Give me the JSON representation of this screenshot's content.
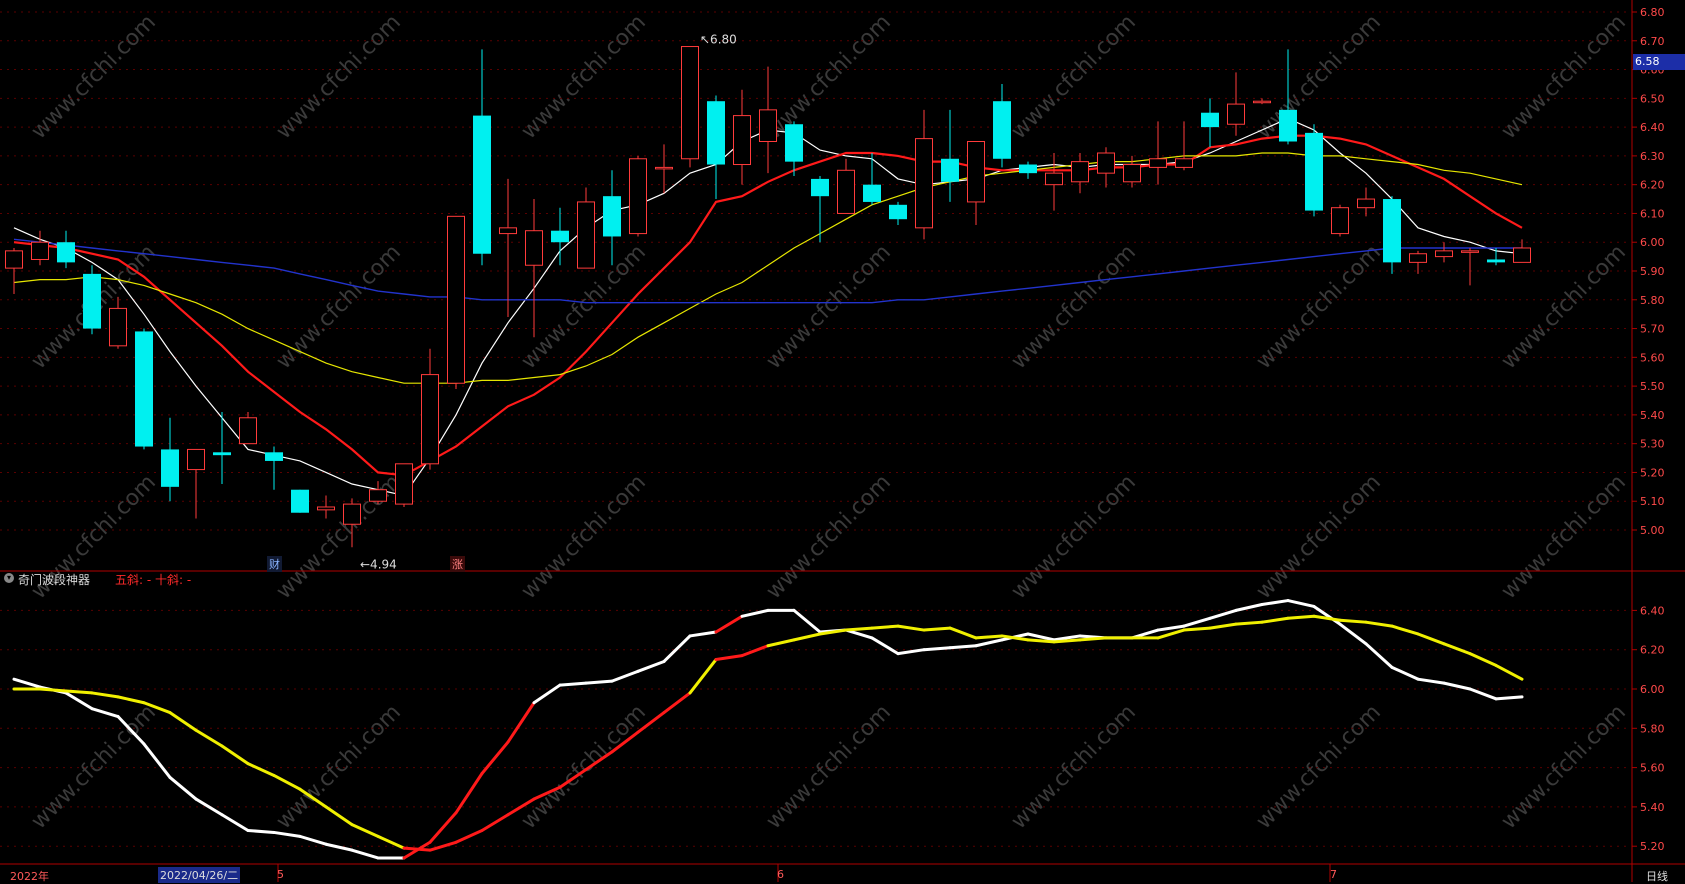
{
  "upper_axis": {
    "ticks": [
      "6.80",
      "6.70",
      "6.60",
      "6.50",
      "6.40",
      "6.30",
      "6.20",
      "6.10",
      "6.00",
      "5.90",
      "5.80",
      "5.70",
      "5.60",
      "5.50",
      "5.40",
      "5.30",
      "5.20",
      "5.10",
      "5.00"
    ],
    "last_price": "6.58"
  },
  "lower_axis": {
    "ticks": [
      "6.40",
      "6.20",
      "6.00",
      "5.80",
      "5.60",
      "5.40",
      "5.20"
    ]
  },
  "annotations": {
    "high": "6.80",
    "low": "4.94"
  },
  "markers": {
    "cai": "财",
    "zhang": "涨"
  },
  "indicator": {
    "title": "奇门波段神器",
    "params": "五斜: -  十斜: -"
  },
  "time_axis": {
    "year_label": "2022年",
    "cursor_date": "2022/04/26/二",
    "month_labels": [
      "5",
      "6",
      "7"
    ],
    "period": "日线"
  },
  "watermark": "www.cfchi.com",
  "colors": {
    "bull": "#ff3b3b",
    "bear": "#00f0f0",
    "ma_short": "#ffffff",
    "ma_red": "#ff1a1a",
    "ma_yellow": "#e6e600",
    "ma_blue": "#2233cc",
    "axis": "#b00000"
  },
  "chart_data": {
    "type": "candlestick",
    "ylim": [
      4.94,
      6.84
    ],
    "candles": [
      {
        "o": 5.91,
        "c": 5.97,
        "h": 5.98,
        "l": 5.82
      },
      {
        "o": 5.94,
        "c": 6.0,
        "h": 6.04,
        "l": 5.92
      },
      {
        "o": 6.0,
        "c": 5.93,
        "h": 6.04,
        "l": 5.91
      },
      {
        "o": 5.89,
        "c": 5.7,
        "h": 5.92,
        "l": 5.68
      },
      {
        "o": 5.64,
        "c": 5.77,
        "h": 5.81,
        "l": 5.63
      },
      {
        "o": 5.69,
        "c": 5.29,
        "h": 5.7,
        "l": 5.28
      },
      {
        "o": 5.28,
        "c": 5.15,
        "h": 5.39,
        "l": 5.1
      },
      {
        "o": 5.21,
        "c": 5.28,
        "h": 5.28,
        "l": 5.04
      },
      {
        "o": 5.27,
        "c": 5.26,
        "h": 5.41,
        "l": 5.16
      },
      {
        "o": 5.3,
        "c": 5.39,
        "h": 5.41,
        "l": 5.3
      },
      {
        "o": 5.27,
        "c": 5.24,
        "h": 5.29,
        "l": 5.14
      },
      {
        "o": 5.14,
        "c": 5.06,
        "h": 5.14,
        "l": 5.06
      },
      {
        "o": 5.07,
        "c": 5.08,
        "h": 5.12,
        "l": 5.04
      },
      {
        "o": 5.02,
        "c": 5.09,
        "h": 5.11,
        "l": 4.94
      },
      {
        "o": 5.1,
        "c": 5.14,
        "h": 5.17,
        "l": 5.09
      },
      {
        "o": 5.09,
        "c": 5.23,
        "h": 5.23,
        "l": 5.08
      },
      {
        "o": 5.23,
        "c": 5.54,
        "h": 5.63,
        "l": 5.21
      },
      {
        "o": 5.51,
        "c": 6.09,
        "h": 6.09,
        "l": 5.49
      },
      {
        "o": 6.44,
        "c": 5.96,
        "h": 6.67,
        "l": 5.92
      },
      {
        "o": 6.03,
        "c": 6.05,
        "h": 6.22,
        "l": 5.74
      },
      {
        "o": 5.92,
        "c": 6.04,
        "h": 6.15,
        "l": 5.67
      },
      {
        "o": 6.04,
        "c": 6.0,
        "h": 6.12,
        "l": 5.92
      },
      {
        "o": 5.91,
        "c": 6.14,
        "h": 6.19,
        "l": 5.91
      },
      {
        "o": 6.16,
        "c": 6.02,
        "h": 6.25,
        "l": 5.92
      },
      {
        "o": 6.03,
        "c": 6.29,
        "h": 6.3,
        "l": 6.02
      },
      {
        "o": 6.26,
        "c": 6.26,
        "h": 6.34,
        "l": 6.17
      },
      {
        "o": 6.29,
        "c": 6.68,
        "h": 6.68,
        "l": 6.26
      },
      {
        "o": 6.49,
        "c": 6.27,
        "h": 6.51,
        "l": 6.15
      },
      {
        "o": 6.27,
        "c": 6.44,
        "h": 6.53,
        "l": 6.2
      },
      {
        "o": 6.35,
        "c": 6.46,
        "h": 6.61,
        "l": 6.24
      },
      {
        "o": 6.41,
        "c": 6.28,
        "h": 6.42,
        "l": 6.23
      },
      {
        "o": 6.22,
        "c": 6.16,
        "h": 6.23,
        "l": 6.0
      },
      {
        "o": 6.1,
        "c": 6.25,
        "h": 6.29,
        "l": 6.1
      },
      {
        "o": 6.2,
        "c": 6.14,
        "h": 6.31,
        "l": 6.13
      },
      {
        "o": 6.13,
        "c": 6.08,
        "h": 6.14,
        "l": 6.06
      },
      {
        "o": 6.05,
        "c": 6.36,
        "h": 6.46,
        "l": 6.01
      },
      {
        "o": 6.29,
        "c": 6.21,
        "h": 6.46,
        "l": 6.14
      },
      {
        "o": 6.14,
        "c": 6.35,
        "h": 6.35,
        "l": 6.06
      },
      {
        "o": 6.49,
        "c": 6.29,
        "h": 6.55,
        "l": 6.26
      },
      {
        "o": 6.27,
        "c": 6.24,
        "h": 6.28,
        "l": 6.22
      },
      {
        "o": 6.2,
        "c": 6.24,
        "h": 6.31,
        "l": 6.11
      },
      {
        "o": 6.21,
        "c": 6.28,
        "h": 6.31,
        "l": 6.17
      },
      {
        "o": 6.24,
        "c": 6.31,
        "h": 6.33,
        "l": 6.19
      },
      {
        "o": 6.21,
        "c": 6.27,
        "h": 6.3,
        "l": 6.19
      },
      {
        "o": 6.26,
        "c": 6.29,
        "h": 6.42,
        "l": 6.2
      },
      {
        "o": 6.26,
        "c": 6.29,
        "h": 6.42,
        "l": 6.25
      },
      {
        "o": 6.45,
        "c": 6.4,
        "h": 6.5,
        "l": 6.33
      },
      {
        "o": 6.41,
        "c": 6.48,
        "h": 6.59,
        "l": 6.37
      },
      {
        "o": 6.49,
        "c": 6.49,
        "h": 6.5,
        "l": 6.48
      },
      {
        "o": 6.46,
        "c": 6.35,
        "h": 6.67,
        "l": 6.34
      },
      {
        "o": 6.38,
        "c": 6.11,
        "h": 6.41,
        "l": 6.09
      },
      {
        "o": 6.03,
        "c": 6.12,
        "h": 6.13,
        "l": 6.02
      },
      {
        "o": 6.12,
        "c": 6.15,
        "h": 6.19,
        "l": 6.09
      },
      {
        "o": 6.15,
        "c": 5.93,
        "h": 6.16,
        "l": 5.89
      },
      {
        "o": 5.93,
        "c": 5.96,
        "h": 5.97,
        "l": 5.89
      },
      {
        "o": 5.95,
        "c": 5.97,
        "h": 6.0,
        "l": 5.93
      },
      {
        "o": 5.97,
        "c": 5.97,
        "h": 5.98,
        "l": 5.85
      },
      {
        "o": 5.94,
        "c": 5.93,
        "h": 5.98,
        "l": 5.92
      },
      {
        "o": 5.93,
        "c": 5.98,
        "h": 6.01,
        "l": 5.93
      }
    ],
    "series": [
      {
        "name": "MA5",
        "values": [
          6.05,
          6.01,
          5.98,
          5.93,
          5.87,
          5.75,
          5.62,
          5.5,
          5.39,
          5.28,
          5.26,
          5.24,
          5.2,
          5.16,
          5.14,
          5.12,
          5.25,
          5.4,
          5.58,
          5.72,
          5.84,
          5.97,
          6.05,
          6.11,
          6.13,
          6.17,
          6.24,
          6.27,
          6.35,
          6.39,
          6.38,
          6.32,
          6.3,
          6.29,
          6.22,
          6.2,
          6.21,
          6.22,
          6.25,
          6.26,
          6.27,
          6.26,
          6.27,
          6.27,
          6.27,
          6.28,
          6.31,
          6.35,
          6.39,
          6.43,
          6.39,
          6.31,
          6.24,
          6.15,
          6.05,
          6.02,
          6.0,
          5.97,
          5.96
        ]
      },
      {
        "name": "MA10",
        "values": [
          6.0,
          5.99,
          5.98,
          5.96,
          5.94,
          5.88,
          5.8,
          5.72,
          5.64,
          5.55,
          5.48,
          5.41,
          5.35,
          5.28,
          5.2,
          5.19,
          5.24,
          5.29,
          5.36,
          5.43,
          5.47,
          5.53,
          5.62,
          5.72,
          5.82,
          5.91,
          6.0,
          6.14,
          6.16,
          6.21,
          6.25,
          6.28,
          6.31,
          6.31,
          6.3,
          6.28,
          6.28,
          6.26,
          6.25,
          6.25,
          6.25,
          6.25,
          6.26,
          6.26,
          6.27,
          6.27,
          6.33,
          6.34,
          6.36,
          6.37,
          6.37,
          6.36,
          6.34,
          6.3,
          6.26,
          6.22,
          6.16,
          6.1,
          6.05
        ]
      },
      {
        "name": "MA20",
        "values": [
          5.86,
          5.87,
          5.87,
          5.88,
          5.87,
          5.85,
          5.82,
          5.79,
          5.75,
          5.7,
          5.66,
          5.62,
          5.58,
          5.55,
          5.53,
          5.51,
          5.51,
          5.51,
          5.52,
          5.52,
          5.53,
          5.54,
          5.57,
          5.61,
          5.67,
          5.72,
          5.77,
          5.82,
          5.86,
          5.92,
          5.98,
          6.03,
          6.08,
          6.13,
          6.16,
          6.19,
          6.21,
          6.23,
          6.24,
          6.25,
          6.26,
          6.27,
          6.28,
          6.28,
          6.29,
          6.3,
          6.3,
          6.3,
          6.31,
          6.31,
          6.3,
          6.3,
          6.29,
          6.28,
          6.27,
          6.25,
          6.24,
          6.22,
          6.2
        ]
      },
      {
        "name": "MA60",
        "values": [
          6.01,
          6.0,
          5.99,
          5.98,
          5.97,
          5.96,
          5.95,
          5.94,
          5.93,
          5.92,
          5.91,
          5.89,
          5.87,
          5.85,
          5.83,
          5.82,
          5.81,
          5.81,
          5.8,
          5.8,
          5.8,
          5.8,
          5.79,
          5.79,
          5.79,
          5.79,
          5.79,
          5.79,
          5.79,
          5.79,
          5.79,
          5.79,
          5.79,
          5.79,
          5.8,
          5.8,
          5.81,
          5.82,
          5.83,
          5.84,
          5.85,
          5.86,
          5.87,
          5.88,
          5.89,
          5.9,
          5.91,
          5.92,
          5.93,
          5.94,
          5.95,
          5.96,
          5.97,
          5.98,
          5.98,
          5.98,
          5.98,
          5.98,
          5.98
        ]
      }
    ],
    "indicator_ylim": [
      5.1,
      6.53
    ],
    "indicator_series": [
      {
        "name": "五斜",
        "values": [
          6.05,
          6.01,
          5.98,
          5.9,
          5.86,
          5.72,
          5.55,
          5.44,
          5.36,
          5.28,
          5.27,
          5.25,
          5.21,
          5.18,
          5.14,
          5.14,
          5.22,
          5.37,
          5.57,
          5.73,
          5.93,
          6.02,
          6.03,
          6.04,
          6.09,
          6.14,
          6.27,
          6.29,
          6.37,
          6.4,
          6.4,
          6.29,
          6.3,
          6.26,
          6.18,
          6.2,
          6.21,
          6.22,
          6.25,
          6.28,
          6.25,
          6.27,
          6.26,
          6.26,
          6.3,
          6.32,
          6.36,
          6.4,
          6.43,
          6.45,
          6.42,
          6.33,
          6.23,
          6.11,
          6.05,
          6.03,
          6.0,
          5.95,
          5.96
        ],
        "colors": [
          "w",
          "w",
          "w",
          "w",
          "w",
          "w",
          "w",
          "w",
          "w",
          "w",
          "w",
          "w",
          "w",
          "w",
          "w",
          "r",
          "r",
          "r",
          "r",
          "r",
          "w",
          "w",
          "w",
          "w",
          "w",
          "w",
          "w",
          "r",
          "w",
          "w",
          "w",
          "w",
          "w",
          "w",
          "w",
          "w",
          "w",
          "w",
          "w",
          "w",
          "w",
          "w",
          "w",
          "w",
          "w",
          "w",
          "w",
          "w",
          "w",
          "w",
          "w",
          "w",
          "w",
          "w",
          "w",
          "w",
          "w",
          "w"
        ]
      },
      {
        "name": "十斜",
        "values": [
          6.0,
          6.0,
          5.99,
          5.98,
          5.96,
          5.93,
          5.88,
          5.79,
          5.71,
          5.62,
          5.56,
          5.49,
          5.4,
          5.31,
          5.25,
          5.19,
          5.18,
          5.22,
          5.28,
          5.36,
          5.44,
          5.5,
          5.59,
          5.68,
          5.78,
          5.88,
          5.98,
          6.15,
          6.17,
          6.22,
          6.25,
          6.28,
          6.3,
          6.31,
          6.32,
          6.3,
          6.31,
          6.26,
          6.27,
          6.25,
          6.24,
          6.25,
          6.26,
          6.26,
          6.26,
          6.3,
          6.31,
          6.33,
          6.34,
          6.36,
          6.37,
          6.35,
          6.34,
          6.32,
          6.28,
          6.23,
          6.18,
          6.12,
          6.05
        ],
        "colors": [
          "y",
          "y",
          "y",
          "y",
          "y",
          "y",
          "y",
          "y",
          "y",
          "y",
          "y",
          "y",
          "y",
          "y",
          "y",
          "r",
          "r",
          "r",
          "r",
          "r",
          "r",
          "r",
          "r",
          "r",
          "r",
          "r",
          "y",
          "r",
          "r",
          "y",
          "y",
          "y",
          "y",
          "y",
          "y",
          "y",
          "y",
          "y",
          "y",
          "y",
          "y",
          "y",
          "y",
          "y",
          "y",
          "y",
          "y",
          "y",
          "y",
          "y",
          "y",
          "y",
          "y",
          "y",
          "y",
          "y",
          "y",
          "y"
        ]
      }
    ]
  }
}
